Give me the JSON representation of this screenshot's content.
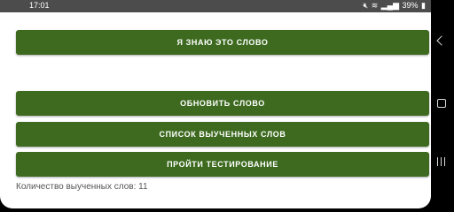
{
  "status_bar": {
    "time": "17:01",
    "battery": "39%",
    "icons": [
      "mute-icon",
      "wifi-icon",
      "signal-icon",
      "battery-icon"
    ]
  },
  "main": {
    "know_word_button": "Я ЗНАЮ ЭТО СЛОВО",
    "refresh_word_button": "ОБНОВИТЬ СЛОВО",
    "learned_list_button": "СПИСОК ВЫУЧЕННЫХ СЛОВ",
    "start_test_button": "ПРОЙТИ ТЕСТИРОВАНИЕ",
    "learned_count_text": "Количество выученных слов: 11"
  },
  "nav_bar": {
    "buttons": [
      "back-icon",
      "home-icon",
      "recents-icon"
    ]
  },
  "colors": {
    "button_background": "#3d6a1f",
    "button_text": "#ffffff",
    "status_bar": "#4c4c4c"
  }
}
